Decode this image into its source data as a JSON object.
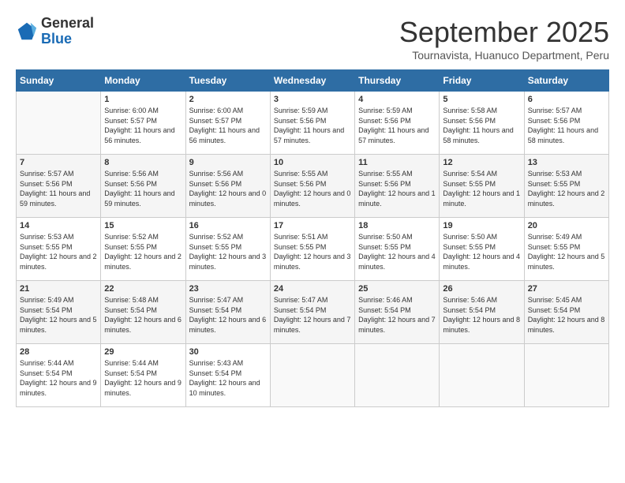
{
  "logo": {
    "general": "General",
    "blue": "Blue"
  },
  "header": {
    "month": "September 2025",
    "location": "Tournavista, Huanuco Department, Peru"
  },
  "weekdays": [
    "Sunday",
    "Monday",
    "Tuesday",
    "Wednesday",
    "Thursday",
    "Friday",
    "Saturday"
  ],
  "weeks": [
    [
      {
        "day": "",
        "sunrise": "",
        "sunset": "",
        "daylight": ""
      },
      {
        "day": "1",
        "sunrise": "Sunrise: 6:00 AM",
        "sunset": "Sunset: 5:57 PM",
        "daylight": "Daylight: 11 hours and 56 minutes."
      },
      {
        "day": "2",
        "sunrise": "Sunrise: 6:00 AM",
        "sunset": "Sunset: 5:57 PM",
        "daylight": "Daylight: 11 hours and 56 minutes."
      },
      {
        "day": "3",
        "sunrise": "Sunrise: 5:59 AM",
        "sunset": "Sunset: 5:56 PM",
        "daylight": "Daylight: 11 hours and 57 minutes."
      },
      {
        "day": "4",
        "sunrise": "Sunrise: 5:59 AM",
        "sunset": "Sunset: 5:56 PM",
        "daylight": "Daylight: 11 hours and 57 minutes."
      },
      {
        "day": "5",
        "sunrise": "Sunrise: 5:58 AM",
        "sunset": "Sunset: 5:56 PM",
        "daylight": "Daylight: 11 hours and 58 minutes."
      },
      {
        "day": "6",
        "sunrise": "Sunrise: 5:57 AM",
        "sunset": "Sunset: 5:56 PM",
        "daylight": "Daylight: 11 hours and 58 minutes."
      }
    ],
    [
      {
        "day": "7",
        "sunrise": "Sunrise: 5:57 AM",
        "sunset": "Sunset: 5:56 PM",
        "daylight": "Daylight: 11 hours and 59 minutes."
      },
      {
        "day": "8",
        "sunrise": "Sunrise: 5:56 AM",
        "sunset": "Sunset: 5:56 PM",
        "daylight": "Daylight: 11 hours and 59 minutes."
      },
      {
        "day": "9",
        "sunrise": "Sunrise: 5:56 AM",
        "sunset": "Sunset: 5:56 PM",
        "daylight": "Daylight: 12 hours and 0 minutes."
      },
      {
        "day": "10",
        "sunrise": "Sunrise: 5:55 AM",
        "sunset": "Sunset: 5:56 PM",
        "daylight": "Daylight: 12 hours and 0 minutes."
      },
      {
        "day": "11",
        "sunrise": "Sunrise: 5:55 AM",
        "sunset": "Sunset: 5:56 PM",
        "daylight": "Daylight: 12 hours and 1 minute."
      },
      {
        "day": "12",
        "sunrise": "Sunrise: 5:54 AM",
        "sunset": "Sunset: 5:55 PM",
        "daylight": "Daylight: 12 hours and 1 minute."
      },
      {
        "day": "13",
        "sunrise": "Sunrise: 5:53 AM",
        "sunset": "Sunset: 5:55 PM",
        "daylight": "Daylight: 12 hours and 2 minutes."
      }
    ],
    [
      {
        "day": "14",
        "sunrise": "Sunrise: 5:53 AM",
        "sunset": "Sunset: 5:55 PM",
        "daylight": "Daylight: 12 hours and 2 minutes."
      },
      {
        "day": "15",
        "sunrise": "Sunrise: 5:52 AM",
        "sunset": "Sunset: 5:55 PM",
        "daylight": "Daylight: 12 hours and 2 minutes."
      },
      {
        "day": "16",
        "sunrise": "Sunrise: 5:52 AM",
        "sunset": "Sunset: 5:55 PM",
        "daylight": "Daylight: 12 hours and 3 minutes."
      },
      {
        "day": "17",
        "sunrise": "Sunrise: 5:51 AM",
        "sunset": "Sunset: 5:55 PM",
        "daylight": "Daylight: 12 hours and 3 minutes."
      },
      {
        "day": "18",
        "sunrise": "Sunrise: 5:50 AM",
        "sunset": "Sunset: 5:55 PM",
        "daylight": "Daylight: 12 hours and 4 minutes."
      },
      {
        "day": "19",
        "sunrise": "Sunrise: 5:50 AM",
        "sunset": "Sunset: 5:55 PM",
        "daylight": "Daylight: 12 hours and 4 minutes."
      },
      {
        "day": "20",
        "sunrise": "Sunrise: 5:49 AM",
        "sunset": "Sunset: 5:55 PM",
        "daylight": "Daylight: 12 hours and 5 minutes."
      }
    ],
    [
      {
        "day": "21",
        "sunrise": "Sunrise: 5:49 AM",
        "sunset": "Sunset: 5:54 PM",
        "daylight": "Daylight: 12 hours and 5 minutes."
      },
      {
        "day": "22",
        "sunrise": "Sunrise: 5:48 AM",
        "sunset": "Sunset: 5:54 PM",
        "daylight": "Daylight: 12 hours and 6 minutes."
      },
      {
        "day": "23",
        "sunrise": "Sunrise: 5:47 AM",
        "sunset": "Sunset: 5:54 PM",
        "daylight": "Daylight: 12 hours and 6 minutes."
      },
      {
        "day": "24",
        "sunrise": "Sunrise: 5:47 AM",
        "sunset": "Sunset: 5:54 PM",
        "daylight": "Daylight: 12 hours and 7 minutes."
      },
      {
        "day": "25",
        "sunrise": "Sunrise: 5:46 AM",
        "sunset": "Sunset: 5:54 PM",
        "daylight": "Daylight: 12 hours and 7 minutes."
      },
      {
        "day": "26",
        "sunrise": "Sunrise: 5:46 AM",
        "sunset": "Sunset: 5:54 PM",
        "daylight": "Daylight: 12 hours and 8 minutes."
      },
      {
        "day": "27",
        "sunrise": "Sunrise: 5:45 AM",
        "sunset": "Sunset: 5:54 PM",
        "daylight": "Daylight: 12 hours and 8 minutes."
      }
    ],
    [
      {
        "day": "28",
        "sunrise": "Sunrise: 5:44 AM",
        "sunset": "Sunset: 5:54 PM",
        "daylight": "Daylight: 12 hours and 9 minutes."
      },
      {
        "day": "29",
        "sunrise": "Sunrise: 5:44 AM",
        "sunset": "Sunset: 5:54 PM",
        "daylight": "Daylight: 12 hours and 9 minutes."
      },
      {
        "day": "30",
        "sunrise": "Sunrise: 5:43 AM",
        "sunset": "Sunset: 5:54 PM",
        "daylight": "Daylight: 12 hours and 10 minutes."
      },
      {
        "day": "",
        "sunrise": "",
        "sunset": "",
        "daylight": ""
      },
      {
        "day": "",
        "sunrise": "",
        "sunset": "",
        "daylight": ""
      },
      {
        "day": "",
        "sunrise": "",
        "sunset": "",
        "daylight": ""
      },
      {
        "day": "",
        "sunrise": "",
        "sunset": "",
        "daylight": ""
      }
    ]
  ]
}
